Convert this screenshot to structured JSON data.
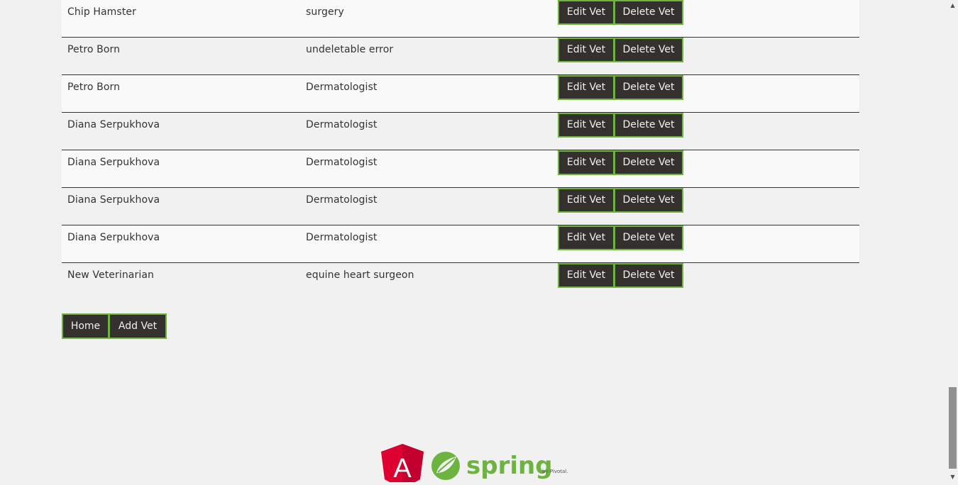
{
  "vets": [
    {
      "name": "Chip Hamster",
      "specialty": "surgery"
    },
    {
      "name": "Petro Born",
      "specialty": "undeletable error"
    },
    {
      "name": "Petro Born",
      "specialty": "Dermatologist"
    },
    {
      "name": "Diana Serpukhova",
      "specialty": "Dermatologist"
    },
    {
      "name": "Diana Serpukhova",
      "specialty": "Dermatologist"
    },
    {
      "name": "Diana Serpukhova",
      "specialty": "Dermatologist"
    },
    {
      "name": "Diana Serpukhova",
      "specialty": "Dermatologist"
    },
    {
      "name": "New Veterinarian",
      "specialty": "equine heart surgeon"
    }
  ],
  "actions": {
    "edit_label": "Edit Vet",
    "delete_label": "Delete Vet"
  },
  "bottom": {
    "home_label": "Home",
    "add_label": "Add Vet"
  },
  "footer": {
    "angular_logo_letter": "A",
    "spring_word": "spring",
    "spring_byline": "by Pivotal."
  },
  "colors": {
    "accent": "#6db33f",
    "button_bg": "#34302d",
    "angular_red": "#dd0031"
  }
}
